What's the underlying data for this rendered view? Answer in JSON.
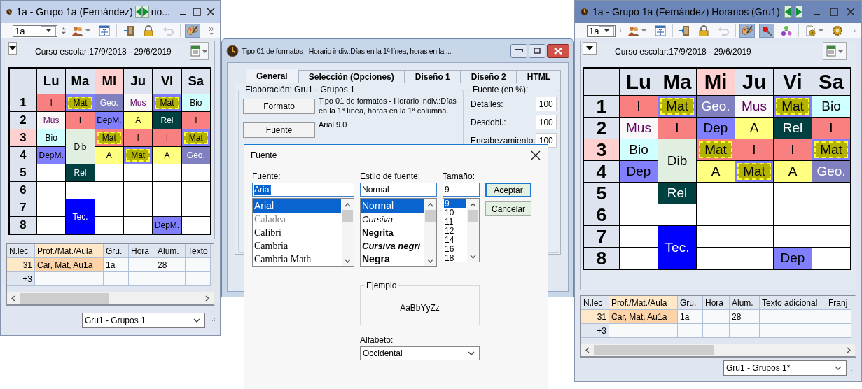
{
  "schedule_windows": [
    {
      "title": "1a - Grupo 1a (Fernández)",
      "title_rest": "rio...",
      "active": false,
      "toolbar": {
        "class_value": "1a",
        "buttons": [
          {
            "kind": "people",
            "menu": true,
            "pressed": false,
            "disabled": false
          },
          {
            "kind": "table",
            "menu": false,
            "pressed": false,
            "disabled": false
          },
          {
            "kind": "separator"
          },
          {
            "kind": "door",
            "menu": false,
            "pressed": false,
            "disabled": false
          },
          {
            "kind": "lock",
            "menu": false,
            "pressed": false,
            "disabled": false
          },
          {
            "kind": "undo",
            "menu": false,
            "pressed": false,
            "disabled": true
          },
          {
            "kind": "separator"
          },
          {
            "kind": "palette",
            "menu": false,
            "pressed": true,
            "disabled": false
          }
        ]
      },
      "period": "Curso escolar:17/9/2018 - 29/6/2019",
      "timetable": {
        "days": [
          {
            "label": "Lu",
            "highlighted": false
          },
          {
            "label": "Ma",
            "highlighted": false
          },
          {
            "label": "Mi",
            "highlighted": true
          },
          {
            "label": "Ju",
            "highlighted": false
          },
          {
            "label": "Vi",
            "highlighted": false
          },
          {
            "label": "Sa",
            "highlighted": false
          }
        ],
        "rows": [
          {
            "label": "1",
            "highlighted": false,
            "cells": [
              {
                "kind": "lesson",
                "text": "I",
                "color": "#f88080"
              },
              {
                "kind": "marked",
                "text": "Mat",
                "color": "#8080ff"
              },
              {
                "kind": "lesson",
                "text": "Geo.",
                "color": "#8080c0"
              },
              {
                "kind": "accent",
                "text": "Mus",
                "color": "#f8f8f8"
              },
              {
                "kind": "marked",
                "text": "Mat",
                "color": "#8080ff"
              },
              {
                "kind": "lesson",
                "text": "Bio",
                "color": "#d0ffff"
              }
            ]
          },
          {
            "label": "2",
            "highlighted": false,
            "cells": [
              {
                "kind": "accent",
                "text": "Mus",
                "color": "#f8f8f8"
              },
              {
                "kind": "lesson",
                "text": "I",
                "color": "#f88080"
              },
              {
                "kind": "lesson",
                "text": "DepM.",
                "color": "#8080ff"
              },
              {
                "kind": "lesson",
                "text": "A",
                "color": "#ffff80"
              },
              {
                "kind": "lesson",
                "text": "Rel",
                "color": "#004040"
              },
              {
                "kind": "lesson",
                "text": "I",
                "color": "#f88080"
              }
            ]
          },
          {
            "label": "3",
            "highlighted": true,
            "cells": [
              {
                "kind": "lesson",
                "text": "Bio",
                "color": "#d0ffff"
              },
              {
                "kind": "double",
                "text": "Dib",
                "color": "#e0efe0"
              },
              {
                "kind": "marked",
                "text": "Mat",
                "color": "#f88080"
              },
              {
                "kind": "lesson",
                "text": "I",
                "color": "#f88080"
              },
              {
                "kind": "lesson",
                "text": "I",
                "color": "#f88080"
              },
              {
                "kind": "marked",
                "text": "Mat",
                "color": "#8080ff"
              }
            ]
          },
          {
            "label": "4",
            "highlighted": false,
            "cells": [
              {
                "kind": "lesson",
                "text": "DepM.",
                "color": "#8080ff"
              },
              "",
              {
                "kind": "lesson",
                "text": "A",
                "color": "#ffff80"
              },
              {
                "kind": "marked",
                "text": "Mat",
                "color": "#8080ff"
              },
              {
                "kind": "lesson",
                "text": "A",
                "color": "#ffff80"
              },
              {
                "kind": "lesson",
                "text": "Geo.",
                "color": "#8080c0"
              }
            ]
          },
          {
            "label": "5",
            "highlighted": false,
            "cells": [
              {
                "kind": "empty"
              },
              {
                "kind": "lesson",
                "text": "Rel",
                "color": "#004040"
              },
              {
                "kind": "empty"
              },
              {
                "kind": "empty"
              },
              {
                "kind": "empty"
              },
              {
                "kind": "empty"
              }
            ]
          },
          {
            "label": "6",
            "highlighted": false,
            "cells": [
              {
                "kind": "empty"
              },
              {
                "kind": "empty"
              },
              {
                "kind": "empty"
              },
              {
                "kind": "empty"
              },
              {
                "kind": "empty"
              },
              {
                "kind": "empty"
              }
            ]
          },
          {
            "label": "7",
            "highlighted": false,
            "cells": [
              {
                "kind": "empty"
              },
              {
                "kind": "double",
                "text": "Tec.",
                "color": "#0000ff"
              },
              {
                "kind": "empty"
              },
              {
                "kind": "empty"
              },
              {
                "kind": "empty"
              },
              {
                "kind": "empty"
              }
            ]
          },
          {
            "label": "8",
            "highlighted": false,
            "cells": [
              {
                "kind": "empty"
              },
              "",
              {
                "kind": "empty"
              },
              {
                "kind": "empty"
              },
              {
                "kind": "lesson",
                "text": "DepM.",
                "color": "#8080ff"
              },
              {
                "kind": "empty"
              }
            ]
          }
        ]
      },
      "lessons": {
        "columns": [
          {
            "label": "N.lec",
            "highlighted": false
          },
          {
            "label": "Prof./Mat./Aula",
            "highlighted": true
          },
          {
            "label": "Gru.",
            "highlighted": false
          },
          {
            "label": "Hora",
            "highlighted": false
          },
          {
            "label": "Alum.",
            "highlighted": false
          },
          {
            "label": "Texto",
            "highlighted": false
          }
        ],
        "rows": [
          {
            "highlighted": true,
            "cells": [
              "31",
              "Car, Mat, Au1a",
              "1a",
              null,
              "28",
              null
            ]
          },
          {
            "highlighted": false,
            "cells": [
              "+3",
              null,
              null,
              null,
              null,
              null
            ]
          }
        ]
      },
      "group_select": "Gru1 - Grupos 1"
    },
    {
      "title": "1a - Grupo 1a (Fernández)  Horarios  (Gru1)",
      "active": true,
      "toolbar": {
        "class_value": "1a",
        "buttons": [
          {
            "kind": "people",
            "menu": true,
            "pressed": false,
            "disabled": false
          },
          {
            "kind": "table",
            "menu": false,
            "pressed": false,
            "disabled": false
          },
          {
            "kind": "separator"
          },
          {
            "kind": "door",
            "menu": false,
            "pressed": false,
            "disabled": false
          },
          {
            "kind": "lock",
            "menu": false,
            "pressed": false,
            "disabled": false
          },
          {
            "kind": "undo",
            "menu": false,
            "pressed": false,
            "disabled": true
          },
          {
            "kind": "separator"
          },
          {
            "kind": "palette",
            "menu": false,
            "pressed": true,
            "disabled": false
          },
          {
            "kind": "pin",
            "menu": false,
            "pressed": true,
            "disabled": false
          },
          {
            "kind": "nodes",
            "menu": false,
            "pressed": false,
            "disabled": false
          },
          {
            "kind": "separator"
          },
          {
            "kind": "page-gear",
            "menu": true,
            "pressed": false,
            "disabled": false
          },
          {
            "kind": "gear",
            "menu": false,
            "pressed": false,
            "disabled": false
          }
        ]
      },
      "period": "Curso escolar:17/9/2018 - 29/6/2019",
      "timetable": {
        "days": [
          {
            "label": "Lu",
            "highlighted": false
          },
          {
            "label": "Ma",
            "highlighted": false
          },
          {
            "label": "Mi",
            "highlighted": true
          },
          {
            "label": "Ju",
            "highlighted": false
          },
          {
            "label": "Vi",
            "highlighted": false
          },
          {
            "label": "Sa",
            "highlighted": false
          }
        ],
        "rows": [
          {
            "label": "1",
            "highlighted": false,
            "cells": [
              {
                "kind": "lesson",
                "text": "I",
                "color": "#f88080"
              },
              {
                "kind": "marked",
                "text": "Mat",
                "color": "#8080ff"
              },
              {
                "kind": "lesson",
                "text": "Geo.",
                "color": "#8080c0"
              },
              {
                "kind": "accent",
                "text": "Mus",
                "color": "#f8f8f8"
              },
              {
                "kind": "marked",
                "text": "Mat",
                "color": "#8080ff"
              },
              {
                "kind": "lesson",
                "text": "Bio",
                "color": "#d0ffff"
              }
            ]
          },
          {
            "label": "2",
            "highlighted": false,
            "cells": [
              {
                "kind": "accent",
                "text": "Mus",
                "color": "#f8f8f8"
              },
              {
                "kind": "lesson",
                "text": "I",
                "color": "#f88080"
              },
              {
                "kind": "lesson",
                "text": "Dep",
                "color": "#8080ff"
              },
              {
                "kind": "lesson",
                "text": "A",
                "color": "#ffff80"
              },
              {
                "kind": "lesson",
                "text": "Rel",
                "color": "#004040"
              },
              {
                "kind": "lesson",
                "text": "I",
                "color": "#f88080"
              }
            ]
          },
          {
            "label": "3",
            "highlighted": true,
            "cells": [
              {
                "kind": "lesson",
                "text": "Bio",
                "color": "#d0ffff"
              },
              {
                "kind": "double",
                "text": "Dib",
                "color": "#e0efe0"
              },
              {
                "kind": "marked",
                "text": "Mat",
                "color": "#f88080"
              },
              {
                "kind": "lesson",
                "text": "I",
                "color": "#f88080"
              },
              {
                "kind": "lesson",
                "text": "I",
                "color": "#f88080"
              },
              {
                "kind": "marked",
                "text": "Mat",
                "color": "#8080ff"
              }
            ]
          },
          {
            "label": "4",
            "highlighted": false,
            "cells": [
              {
                "kind": "lesson",
                "text": "Dep",
                "color": "#8080ff"
              },
              "",
              {
                "kind": "lesson",
                "text": "A",
                "color": "#ffff80"
              },
              {
                "kind": "marked",
                "text": "Mat",
                "color": "#8080ff"
              },
              {
                "kind": "lesson",
                "text": "A",
                "color": "#ffff80"
              },
              {
                "kind": "lesson",
                "text": "Geo.",
                "color": "#8080c0"
              }
            ]
          },
          {
            "label": "5",
            "highlighted": false,
            "cells": [
              {
                "kind": "empty"
              },
              {
                "kind": "lesson",
                "text": "Rel",
                "color": "#004040"
              },
              {
                "kind": "empty"
              },
              {
                "kind": "empty"
              },
              {
                "kind": "empty"
              },
              {
                "kind": "empty"
              }
            ]
          },
          {
            "label": "6",
            "highlighted": false,
            "cells": [
              {
                "kind": "empty"
              },
              {
                "kind": "empty"
              },
              {
                "kind": "empty"
              },
              {
                "kind": "empty"
              },
              {
                "kind": "empty"
              },
              {
                "kind": "empty"
              }
            ]
          },
          {
            "label": "7",
            "highlighted": false,
            "cells": [
              {
                "kind": "empty"
              },
              {
                "kind": "double",
                "text": "Tec.",
                "color": "#0000ff"
              },
              {
                "kind": "empty"
              },
              {
                "kind": "empty"
              },
              {
                "kind": "empty"
              },
              {
                "kind": "empty"
              }
            ]
          },
          {
            "label": "8",
            "highlighted": false,
            "cells": [
              {
                "kind": "empty"
              },
              "",
              {
                "kind": "empty"
              },
              {
                "kind": "empty"
              },
              {
                "kind": "lesson",
                "text": "Dep",
                "color": "#8080ff"
              },
              {
                "kind": "empty"
              }
            ]
          }
        ]
      },
      "lessons": {
        "columns": [
          {
            "label": "N.lec",
            "highlighted": false
          },
          {
            "label": "Prof./Mat./Aula",
            "highlighted": true
          },
          {
            "label": "Gru.",
            "highlighted": false
          },
          {
            "label": "Hora",
            "highlighted": false
          },
          {
            "label": "Alum.",
            "highlighted": false
          },
          {
            "label": "Texto adicional",
            "highlighted": false
          },
          {
            "label": "Franj",
            "highlighted": false
          }
        ],
        "rows": [
          {
            "highlighted": true,
            "cells": [
              "31",
              "Car, Mat, Au1a",
              "1a",
              null,
              "28",
              null,
              null
            ]
          },
          {
            "highlighted": false,
            "cells": [
              "+3",
              null,
              null,
              null,
              null,
              null,
              null
            ]
          }
        ]
      },
      "group_select": "Gru1 - Grupos 1*"
    }
  ],
  "format_dialog": {
    "title": "Tipo 01 de formatos - Horario indiv.:Días en la 1ª línea, horas en la ...",
    "tabs": [
      {
        "label": "General",
        "selected": true
      },
      {
        "label": "Selección (Opciones)",
        "selected": false
      },
      {
        "label": "Diseño 1",
        "selected": false
      },
      {
        "label": "Diseño 2",
        "selected": false
      },
      {
        "label": "HTML",
        "selected": false
      }
    ],
    "elaboration": {
      "legend": "Elaboración: Gru1 - Grupos 1",
      "rows": [
        {
          "button": "Formato",
          "description": "Tipo 01 de formatos - Horario indiv.:Días en la 1ª línea, horas en la 1ª columna."
        },
        {
          "button": "Fuente",
          "description": "Arial 9.0"
        }
      ]
    },
    "font_scale": {
      "legend": "Fuente (en %):",
      "rows": [
        {
          "label": "Detalles:",
          "value": "100"
        },
        {
          "label": "Desdobl.:",
          "value": "100"
        },
        {
          "label": "Encabezamiento:",
          "value": "100"
        }
      ]
    }
  },
  "font_dialog": {
    "title": "Fuente",
    "font": {
      "label": "Fuente:",
      "value": "Arial",
      "text_selected": true,
      "items": [
        {
          "text": "Arial",
          "kind": "sans",
          "selected": true,
          "dimmed": false
        },
        {
          "text": "Caladea",
          "kind": "serif",
          "selected": false,
          "dimmed": true
        },
        {
          "text": "Calibri",
          "kind": "serif",
          "selected": false,
          "dimmed": false
        },
        {
          "text": "Cambria",
          "kind": "serif",
          "selected": false,
          "dimmed": false
        },
        {
          "text": "Cambria Math",
          "kind": "serif",
          "selected": false,
          "dimmed": false
        }
      ]
    },
    "style": {
      "label": "Estilo de fuente:",
      "value": "Normal",
      "items": [
        {
          "text": "Normal",
          "kind": "normal",
          "selected": true
        },
        {
          "text": "Cursiva",
          "kind": "italic",
          "selected": false
        },
        {
          "text": "Negrita",
          "kind": "bold",
          "selected": false
        },
        {
          "text": "Cursiva negri",
          "kind": "bold-italic",
          "selected": false
        },
        {
          "text": "Negra",
          "kind": "black",
          "selected": false
        }
      ]
    },
    "size": {
      "label": "Tamaño:",
      "value": "9",
      "items": [
        {
          "text": "9",
          "selected": true
        },
        {
          "text": "10",
          "selected": false
        },
        {
          "text": "11",
          "selected": false
        },
        {
          "text": "12",
          "selected": false
        },
        {
          "text": "14",
          "selected": false
        },
        {
          "text": "16",
          "selected": false
        },
        {
          "text": "18",
          "selected": false
        }
      ]
    },
    "buttons": [
      {
        "label": "Aceptar",
        "default": true
      },
      {
        "label": "Cancelar",
        "default": false
      }
    ],
    "sample": {
      "legend": "Ejemplo",
      "text": "AaBbYyZz"
    },
    "script": {
      "label": "Alfabeto:",
      "value": "Occidental"
    }
  }
}
